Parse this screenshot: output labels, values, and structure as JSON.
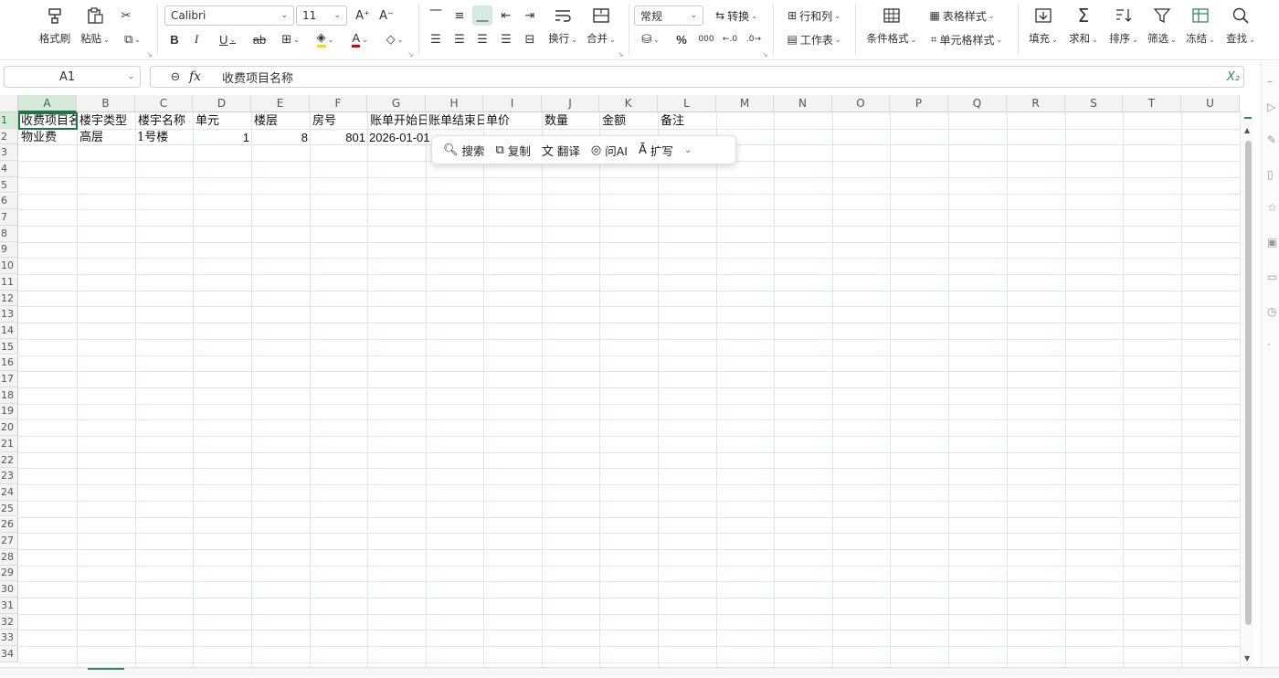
{
  "ribbon": {
    "format_painter": "格式刷",
    "paste": "粘贴",
    "font_name": "Calibri",
    "font_size": "11",
    "number_format": "常规",
    "convert": "转换",
    "rows_cols": "行和列",
    "worksheet": "工作表",
    "conditional_format": "条件格式",
    "table_style": "表格样式",
    "cell_style": "单元格样式",
    "wrap": "换行",
    "merge": "合并",
    "fill": "填充",
    "sum": "求和",
    "sort": "排序",
    "filter": "筛选",
    "freeze": "冻结",
    "find": "查找",
    "bold": "B",
    "italic": "I",
    "underline": "U",
    "percent": "%"
  },
  "formula_bar": {
    "name_box": "A1",
    "fx_label": "fx",
    "content": "收费项目名称"
  },
  "columns": [
    "A",
    "B",
    "C",
    "D",
    "E",
    "F",
    "G",
    "H",
    "I",
    "J",
    "K",
    "L",
    "M",
    "N",
    "O",
    "P",
    "Q",
    "R",
    "S",
    "T",
    "U"
  ],
  "rows": [
    "1",
    "2",
    "3",
    "4",
    "5",
    "6",
    "7",
    "8",
    "9",
    "10",
    "11",
    "12",
    "13",
    "14",
    "15",
    "16",
    "17",
    "18",
    "19",
    "20",
    "21",
    "22",
    "23",
    "24",
    "25",
    "26",
    "27",
    "28",
    "29",
    "30",
    "31",
    "32",
    "33",
    "34"
  ],
  "sheet": {
    "header_row": [
      "收费项目名称",
      "楼宇类型",
      "楼宇名称",
      "单元",
      "楼层",
      "房号",
      "账单开始日期",
      "账单结束日期",
      "单价",
      "数量",
      "金额",
      "备注"
    ],
    "data_row": {
      "a": "物业费",
      "b": "高层",
      "c": "1号楼",
      "d": "1",
      "e": "8",
      "f": "801",
      "g": "2026-01-01"
    }
  },
  "float_toolbar": {
    "search": "搜索",
    "copy": "复制",
    "translate": "翻译",
    "ask_ai": "问AI",
    "expand": "扩写"
  }
}
